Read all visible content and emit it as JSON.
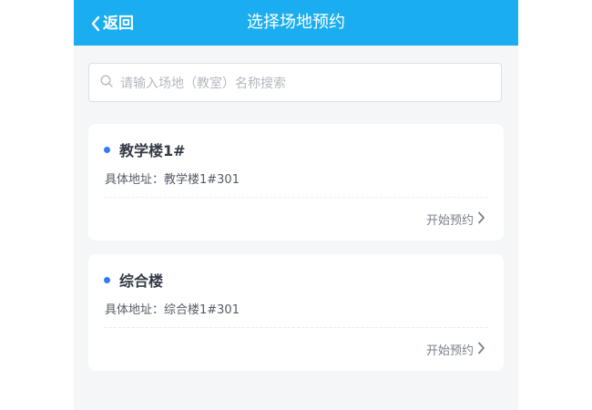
{
  "header": {
    "back_label": "返回",
    "title": "选择场地预约"
  },
  "search": {
    "placeholder": "请输入场地（教室）名称搜索",
    "icon": "search-icon"
  },
  "venues": [
    {
      "name": "教学楼1#",
      "address": "具体地址：教学楼1#301",
      "action_label": "开始预约"
    },
    {
      "name": "综合楼",
      "address": "具体地址：综合楼1#301",
      "action_label": "开始预约"
    }
  ],
  "colors": {
    "header_bg": "#1aaef0",
    "bullet": "#2f7cf6",
    "page_bg": "#f5f6f8"
  }
}
